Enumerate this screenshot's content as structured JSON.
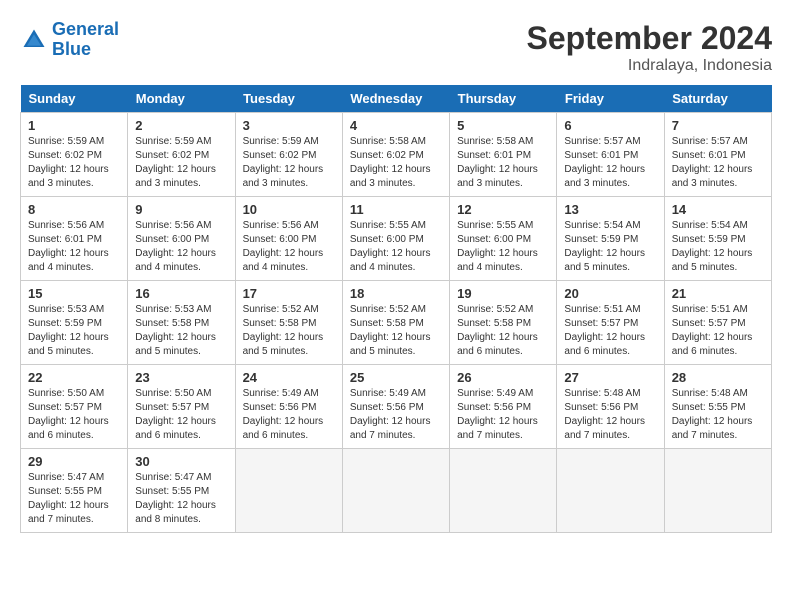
{
  "header": {
    "logo_line1": "General",
    "logo_line2": "Blue",
    "month_title": "September 2024",
    "subtitle": "Indralaya, Indonesia"
  },
  "days_header": [
    "Sunday",
    "Monday",
    "Tuesday",
    "Wednesday",
    "Thursday",
    "Friday",
    "Saturday"
  ],
  "weeks": [
    [
      {
        "day": "1",
        "info": "Sunrise: 5:59 AM\nSunset: 6:02 PM\nDaylight: 12 hours\nand 3 minutes."
      },
      {
        "day": "2",
        "info": "Sunrise: 5:59 AM\nSunset: 6:02 PM\nDaylight: 12 hours\nand 3 minutes."
      },
      {
        "day": "3",
        "info": "Sunrise: 5:59 AM\nSunset: 6:02 PM\nDaylight: 12 hours\nand 3 minutes."
      },
      {
        "day": "4",
        "info": "Sunrise: 5:58 AM\nSunset: 6:02 PM\nDaylight: 12 hours\nand 3 minutes."
      },
      {
        "day": "5",
        "info": "Sunrise: 5:58 AM\nSunset: 6:01 PM\nDaylight: 12 hours\nand 3 minutes."
      },
      {
        "day": "6",
        "info": "Sunrise: 5:57 AM\nSunset: 6:01 PM\nDaylight: 12 hours\nand 3 minutes."
      },
      {
        "day": "7",
        "info": "Sunrise: 5:57 AM\nSunset: 6:01 PM\nDaylight: 12 hours\nand 3 minutes."
      }
    ],
    [
      {
        "day": "8",
        "info": "Sunrise: 5:56 AM\nSunset: 6:01 PM\nDaylight: 12 hours\nand 4 minutes."
      },
      {
        "day": "9",
        "info": "Sunrise: 5:56 AM\nSunset: 6:00 PM\nDaylight: 12 hours\nand 4 minutes."
      },
      {
        "day": "10",
        "info": "Sunrise: 5:56 AM\nSunset: 6:00 PM\nDaylight: 12 hours\nand 4 minutes."
      },
      {
        "day": "11",
        "info": "Sunrise: 5:55 AM\nSunset: 6:00 PM\nDaylight: 12 hours\nand 4 minutes."
      },
      {
        "day": "12",
        "info": "Sunrise: 5:55 AM\nSunset: 6:00 PM\nDaylight: 12 hours\nand 4 minutes."
      },
      {
        "day": "13",
        "info": "Sunrise: 5:54 AM\nSunset: 5:59 PM\nDaylight: 12 hours\nand 5 minutes."
      },
      {
        "day": "14",
        "info": "Sunrise: 5:54 AM\nSunset: 5:59 PM\nDaylight: 12 hours\nand 5 minutes."
      }
    ],
    [
      {
        "day": "15",
        "info": "Sunrise: 5:53 AM\nSunset: 5:59 PM\nDaylight: 12 hours\nand 5 minutes."
      },
      {
        "day": "16",
        "info": "Sunrise: 5:53 AM\nSunset: 5:58 PM\nDaylight: 12 hours\nand 5 minutes."
      },
      {
        "day": "17",
        "info": "Sunrise: 5:52 AM\nSunset: 5:58 PM\nDaylight: 12 hours\nand 5 minutes."
      },
      {
        "day": "18",
        "info": "Sunrise: 5:52 AM\nSunset: 5:58 PM\nDaylight: 12 hours\nand 5 minutes."
      },
      {
        "day": "19",
        "info": "Sunrise: 5:52 AM\nSunset: 5:58 PM\nDaylight: 12 hours\nand 6 minutes."
      },
      {
        "day": "20",
        "info": "Sunrise: 5:51 AM\nSunset: 5:57 PM\nDaylight: 12 hours\nand 6 minutes."
      },
      {
        "day": "21",
        "info": "Sunrise: 5:51 AM\nSunset: 5:57 PM\nDaylight: 12 hours\nand 6 minutes."
      }
    ],
    [
      {
        "day": "22",
        "info": "Sunrise: 5:50 AM\nSunset: 5:57 PM\nDaylight: 12 hours\nand 6 minutes."
      },
      {
        "day": "23",
        "info": "Sunrise: 5:50 AM\nSunset: 5:57 PM\nDaylight: 12 hours\nand 6 minutes."
      },
      {
        "day": "24",
        "info": "Sunrise: 5:49 AM\nSunset: 5:56 PM\nDaylight: 12 hours\nand 6 minutes."
      },
      {
        "day": "25",
        "info": "Sunrise: 5:49 AM\nSunset: 5:56 PM\nDaylight: 12 hours\nand 7 minutes."
      },
      {
        "day": "26",
        "info": "Sunrise: 5:49 AM\nSunset: 5:56 PM\nDaylight: 12 hours\nand 7 minutes."
      },
      {
        "day": "27",
        "info": "Sunrise: 5:48 AM\nSunset: 5:56 PM\nDaylight: 12 hours\nand 7 minutes."
      },
      {
        "day": "28",
        "info": "Sunrise: 5:48 AM\nSunset: 5:55 PM\nDaylight: 12 hours\nand 7 minutes."
      }
    ],
    [
      {
        "day": "29",
        "info": "Sunrise: 5:47 AM\nSunset: 5:55 PM\nDaylight: 12 hours\nand 7 minutes."
      },
      {
        "day": "30",
        "info": "Sunrise: 5:47 AM\nSunset: 5:55 PM\nDaylight: 12 hours\nand 8 minutes."
      },
      {
        "day": "",
        "info": ""
      },
      {
        "day": "",
        "info": ""
      },
      {
        "day": "",
        "info": ""
      },
      {
        "day": "",
        "info": ""
      },
      {
        "day": "",
        "info": ""
      }
    ]
  ]
}
